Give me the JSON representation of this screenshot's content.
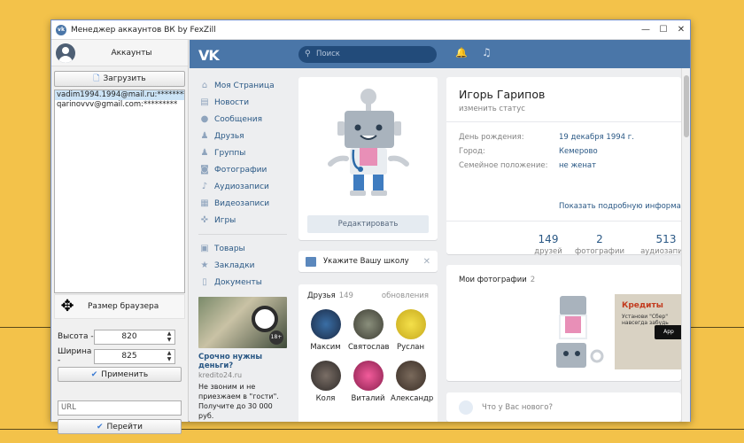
{
  "window": {
    "title": "Менеджер аккаунтов ВК by FexZill",
    "app_icon": "vk",
    "minimize": "—",
    "maximize": "☐",
    "close": "✕"
  },
  "accounts": {
    "header": "Аккаунты",
    "load_button": "Загрузить",
    "items": [
      "vadim1994.1994@mail.ru:*********",
      "qarinovvv@gmail.com:*********"
    ]
  },
  "browser_size": {
    "label": "Размер браузера",
    "height_label": "Высота -",
    "height_value": "820",
    "width_label": "Ширина -",
    "width_value": "825",
    "apply_button": "Применить"
  },
  "url": {
    "placeholder": "URL",
    "go_button": "Перейти"
  },
  "vk": {
    "logo": "VK",
    "search_placeholder": "Поиск",
    "menu": [
      {
        "label": "Моя Страница",
        "icon": "home-icon"
      },
      {
        "label": "Новости",
        "icon": "news-icon"
      },
      {
        "label": "Сообщения",
        "icon": "messages-icon"
      },
      {
        "label": "Друзья",
        "icon": "friends-icon"
      },
      {
        "label": "Группы",
        "icon": "groups-icon"
      },
      {
        "label": "Фотографии",
        "icon": "photos-icon"
      },
      {
        "label": "Аудиозаписи",
        "icon": "audio-icon"
      },
      {
        "label": "Видеозаписи",
        "icon": "video-icon"
      },
      {
        "label": "Игры",
        "icon": "games-icon"
      }
    ],
    "menu2": [
      {
        "label": "Товары",
        "icon": "goods-icon"
      },
      {
        "label": "Закладки",
        "icon": "bookmarks-icon"
      },
      {
        "label": "Документы",
        "icon": "documents-icon"
      }
    ],
    "ad": {
      "badge": "18+",
      "title": "Срочно нужны деньги?",
      "domain": "kredito24.ru",
      "text1": "Не звоним и не",
      "text2": "приезжаем в \"гости\".",
      "text3": "Получите до 30 000 руб."
    },
    "edit_button": "Редактировать",
    "school": "Укажите Вашу школу",
    "school_close": "✕",
    "friends": {
      "title": "Друзья",
      "count": "149",
      "updates": "обновления",
      "list": [
        "Максим",
        "Святослав",
        "Руслан",
        "Коля",
        "Виталий",
        "Александр"
      ]
    },
    "profile": {
      "name": "Игорь Гарипов",
      "status": "изменить статус",
      "birthday_label": "День рождения:",
      "birthday": "19 декабря 1994 г.",
      "city_label": "Город:",
      "city": "Кемерово",
      "family_label": "Семейное положение:",
      "family": "не женат",
      "more": "Показать подробную информацию",
      "stats": [
        {
          "n": "149",
          "l": "друзей"
        },
        {
          "n": "2",
          "l": "фотографии"
        },
        {
          "n": "513",
          "l": "аудиозаписи"
        }
      ]
    },
    "my_photos": {
      "title": "Мои фотографии",
      "count": "2",
      "ad_title": "Кредиты",
      "ad_line": "Установи \"Сбер\" навсегда забудь",
      "ad_app": "App"
    },
    "new_post": "Что у Вас нового?"
  },
  "colors": {
    "vk_blue": "#4a76a8",
    "link": "#2a5885",
    "background": "#f3c24a"
  }
}
